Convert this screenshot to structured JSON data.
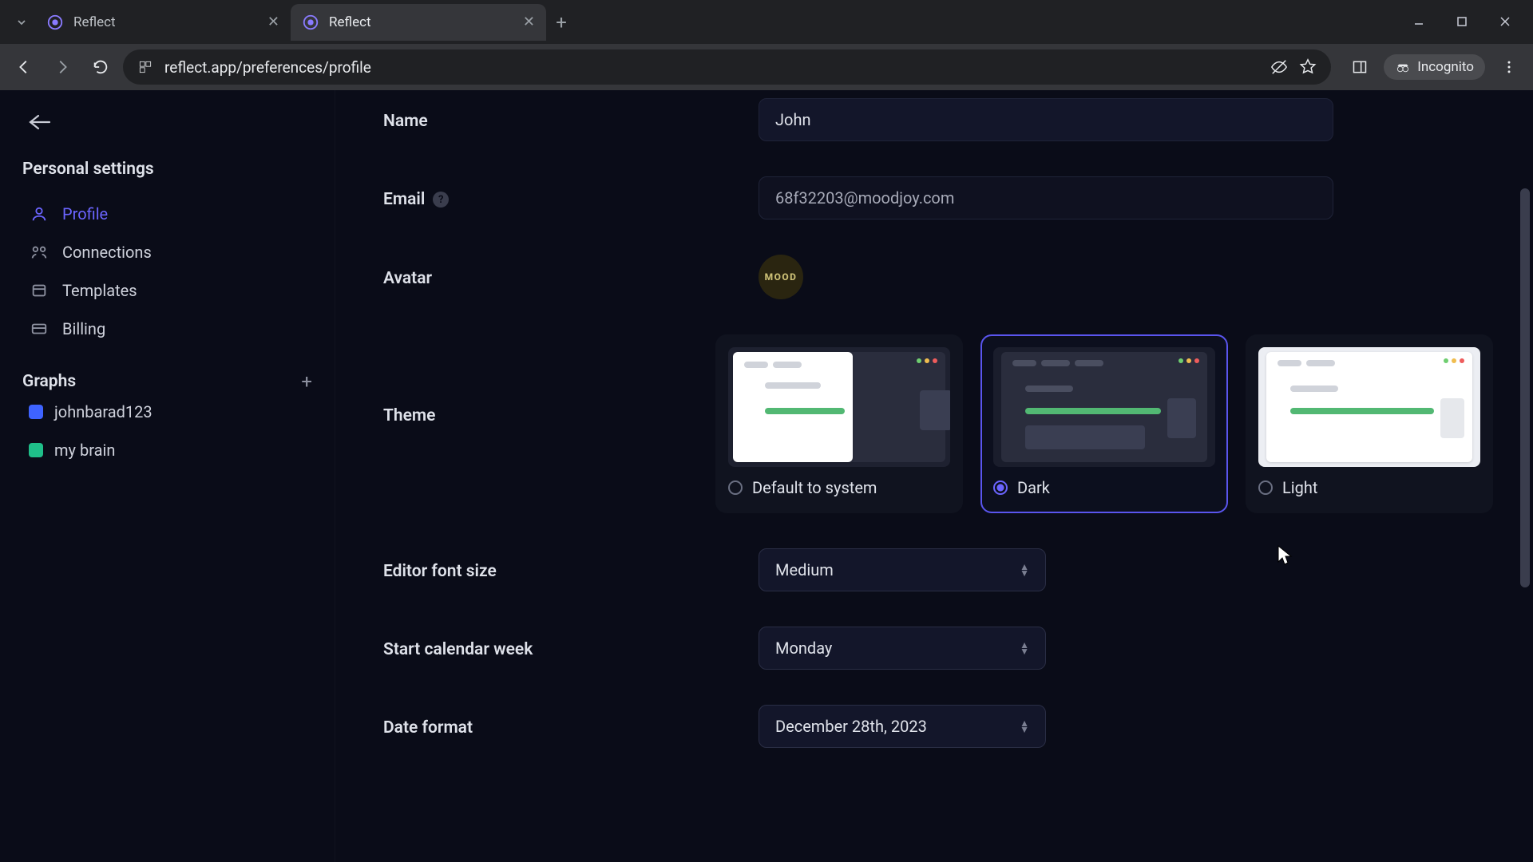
{
  "browser": {
    "tabs": [
      {
        "title": "Reflect",
        "active": false
      },
      {
        "title": "Reflect",
        "active": true
      }
    ],
    "url": "reflect.app/preferences/profile",
    "incognito_label": "Incognito"
  },
  "sidebar": {
    "back_label": "",
    "section_personal": "Personal settings",
    "items": [
      {
        "label": "Profile",
        "active": true
      },
      {
        "label": "Connections",
        "active": false
      },
      {
        "label": "Templates",
        "active": false
      },
      {
        "label": "Billing",
        "active": false
      }
    ],
    "section_graphs": "Graphs",
    "graphs": [
      {
        "label": "johnbarad123",
        "color": "#3e63ff"
      },
      {
        "label": "my brain",
        "color": "#1fbf89"
      }
    ]
  },
  "form": {
    "name_label": "Name",
    "name_value": "John",
    "email_label": "Email",
    "email_value": "68f32203@moodjoy.com",
    "avatar_label": "Avatar",
    "avatar_text": "MOOD",
    "theme_label": "Theme",
    "themes": {
      "system": "Default to system",
      "dark": "Dark",
      "light": "Light",
      "selected": "dark"
    },
    "fontsize_label": "Editor font size",
    "fontsize_value": "Medium",
    "weekstart_label": "Start calendar week",
    "weekstart_value": "Monday",
    "dateformat_label": "Date format",
    "dateformat_value": "December 28th, 2023"
  }
}
